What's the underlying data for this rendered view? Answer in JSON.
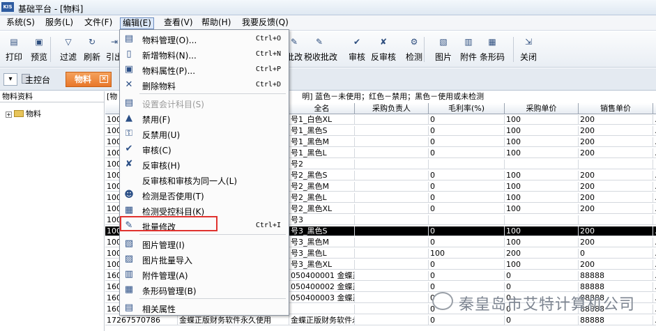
{
  "window": {
    "app_icon": "KIS",
    "title": "基础平台 - [物料]"
  },
  "menubar": [
    {
      "label": "系统(S)",
      "active": false
    },
    {
      "label": "服务(L)",
      "active": false
    },
    {
      "label": "文件(F)",
      "active": false
    },
    {
      "label": "编辑(E)",
      "active": true
    },
    {
      "label": "查看(V)",
      "active": false
    },
    {
      "label": "帮助(H)",
      "active": false
    },
    {
      "label": "我要反馈(Q)",
      "active": false
    }
  ],
  "toolbar": [
    {
      "label": "打印",
      "icon": "printer-icon",
      "glyph": "▤"
    },
    {
      "label": "预览",
      "icon": "preview-icon",
      "glyph": "▣"
    },
    {
      "label": "过滤",
      "icon": "filter-icon",
      "glyph": "▽"
    },
    {
      "label": "刷新",
      "icon": "refresh-icon",
      "glyph": "↻"
    },
    {
      "label": "引出",
      "icon": "export-icon",
      "glyph": "⇥"
    },
    {
      "label": "批改",
      "icon": "batch-edit-icon",
      "glyph": "✎"
    },
    {
      "label": "税收批改",
      "icon": "tax-batch-edit-icon",
      "glyph": "✎"
    },
    {
      "label": "审核",
      "icon": "approve-icon",
      "glyph": "✔"
    },
    {
      "label": "反审核",
      "icon": "unapprove-icon",
      "glyph": "✘"
    },
    {
      "label": "检测",
      "icon": "detect-icon",
      "glyph": "⚙"
    },
    {
      "label": "图片",
      "icon": "picture-icon",
      "glyph": "▧"
    },
    {
      "label": "附件",
      "icon": "attachment-icon",
      "glyph": "▥"
    },
    {
      "label": "条形码",
      "icon": "barcode-icon",
      "glyph": "▦"
    },
    {
      "label": "关闭",
      "icon": "close-door-icon",
      "glyph": "⇲"
    }
  ],
  "tabs": {
    "home": "主控台",
    "current": "物料",
    "close_glyph": "×",
    "nav_glyph": "▾"
  },
  "tree": {
    "header": "物料资料",
    "root": "物料",
    "expander": "+"
  },
  "legend": {
    "prefix": "[物",
    "text": "明] 蓝色－未使用；红色－禁用；黑色－使用或未检测"
  },
  "grid": {
    "columns": [
      {
        "label": ""
      },
      {
        "label": ""
      },
      {
        "label": "全名"
      },
      {
        "label": "采购负责人"
      },
      {
        "label": "毛利率(%)"
      },
      {
        "label": "采购单价"
      },
      {
        "label": "销售单价"
      },
      {
        "label": "…"
      }
    ],
    "rows": [
      [
        "100",
        "",
        "号1_白色XL",
        "",
        "0",
        "100",
        "200",
        "…"
      ],
      [
        "100",
        "",
        "号1_黑色S",
        "",
        "0",
        "100",
        "200",
        "…"
      ],
      [
        "100",
        "",
        "号1_黑色M",
        "",
        "0",
        "100",
        "200",
        "…"
      ],
      [
        "100",
        "",
        "号1_黑色L",
        "",
        "0",
        "100",
        "200",
        "…"
      ],
      [
        "100",
        "",
        "号2",
        "",
        "",
        "",
        "",
        ""
      ],
      [
        "100",
        "",
        "号2_黑色S",
        "",
        "0",
        "100",
        "200",
        "…"
      ],
      [
        "100",
        "",
        "号2_黑色M",
        "",
        "0",
        "100",
        "200",
        "…"
      ],
      [
        "100",
        "",
        "号2_黑色L",
        "",
        "0",
        "100",
        "200",
        "…"
      ],
      [
        "100",
        "",
        "号2_黑色XL",
        "",
        "0",
        "100",
        "200",
        "…"
      ],
      [
        "100",
        "",
        "号3",
        "",
        "",
        "",
        "",
        ""
      ],
      [
        "100",
        "",
        "号3_黑色S",
        "",
        "0",
        "100",
        "200",
        "…"
      ],
      [
        "100",
        "",
        "号3_黑色M",
        "",
        "0",
        "100",
        "200",
        "…"
      ],
      [
        "100",
        "",
        "号3_黑色L",
        "",
        "100",
        "200",
        "0",
        "…"
      ],
      [
        "100",
        "",
        "号3_黑色XL",
        "",
        "0",
        "100",
        "200",
        "…"
      ],
      [
        "160",
        "",
        "050400001 金蝶正",
        "",
        "0",
        "0",
        "88888",
        "…"
      ],
      [
        "160",
        "",
        "050400002 金蝶正",
        "",
        "0",
        "0",
        "88888",
        "…"
      ],
      [
        "160",
        "",
        "050400003 金蝶正",
        "",
        "0",
        "0",
        "88888",
        "…"
      ],
      [
        "160",
        "",
        "",
        "",
        "0",
        "0",
        "88888",
        "…"
      ],
      [
        "17267570786",
        "金蝶正版财务软件永久使用",
        "金蝶正版财务软件永",
        "",
        "0",
        "0",
        "88888",
        "…"
      ]
    ],
    "selected_row": 10
  },
  "edit_menu": [
    {
      "type": "item",
      "label": "物料管理(O)...",
      "shortcut": "Ctrl+O",
      "icon": "material-manage-icon",
      "glyph": "▤",
      "disabled": false
    },
    {
      "type": "item",
      "label": "新增物料(N)...",
      "shortcut": "Ctrl+N",
      "icon": "new-document-icon",
      "glyph": "▯",
      "disabled": false
    },
    {
      "type": "item",
      "label": "物料属性(P)...",
      "shortcut": "Ctrl+P",
      "icon": "properties-icon",
      "glyph": "▣",
      "disabled": false
    },
    {
      "type": "item",
      "label": "删除物料",
      "shortcut": "Ctrl+D",
      "icon": "delete-x-icon",
      "glyph": "✕",
      "disabled": false
    },
    {
      "type": "sep"
    },
    {
      "type": "item",
      "label": "设置会计科目(S)",
      "shortcut": "",
      "icon": "accounting-icon",
      "glyph": "▤",
      "disabled": true
    },
    {
      "type": "item",
      "label": "禁用(F)",
      "shortcut": "",
      "icon": "lock-icon",
      "glyph": "▲",
      "disabled": false
    },
    {
      "type": "item",
      "label": "反禁用(U)",
      "shortcut": "",
      "icon": "key-icon",
      "glyph": "⚿",
      "disabled": false
    },
    {
      "type": "item",
      "label": "审核(C)",
      "shortcut": "",
      "icon": "check-icon",
      "glyph": "✔",
      "disabled": false
    },
    {
      "type": "item",
      "label": "反审核(H)",
      "shortcut": "",
      "icon": "uncheck-icon",
      "glyph": "✘",
      "disabled": false
    },
    {
      "type": "item",
      "label": "反审核和审核为同一人(L)",
      "shortcut": "",
      "icon": "",
      "glyph": "",
      "disabled": false
    },
    {
      "type": "item",
      "label": "检测是否使用(T)",
      "shortcut": "",
      "icon": "user-check-icon",
      "glyph": "☻",
      "disabled": false
    },
    {
      "type": "item",
      "label": "检测受控科目(K)",
      "shortcut": "",
      "icon": "control-account-icon",
      "glyph": "▦",
      "disabled": false
    },
    {
      "type": "item",
      "label": "批量修改",
      "shortcut": "Ctrl+I",
      "icon": "batch-edit-icon",
      "glyph": "✎",
      "disabled": false
    },
    {
      "type": "sep"
    },
    {
      "type": "item",
      "label": "图片管理(I)",
      "shortcut": "",
      "icon": "picture-icon",
      "glyph": "▧",
      "disabled": false
    },
    {
      "type": "item",
      "label": "图片批量导入",
      "shortcut": "",
      "icon": "picture-import-icon",
      "glyph": "▨",
      "disabled": false
    },
    {
      "type": "item",
      "label": "附件管理(A)",
      "shortcut": "",
      "icon": "attachment-icon",
      "glyph": "▥",
      "disabled": false
    },
    {
      "type": "item",
      "label": "条形码管理(B)",
      "shortcut": "",
      "icon": "barcode-icon",
      "glyph": "▦",
      "disabled": false
    },
    {
      "type": "sep"
    },
    {
      "type": "item",
      "label": "相关属性",
      "shortcut": "",
      "icon": "related-properties-icon",
      "glyph": "▤",
      "disabled": false
    }
  ],
  "watermark": "秦皇岛市艾特计算机公司",
  "colors": {
    "tab_active": "#e8772a",
    "highlight_box": "#e0322e",
    "selected_row_bg": "#000000"
  }
}
